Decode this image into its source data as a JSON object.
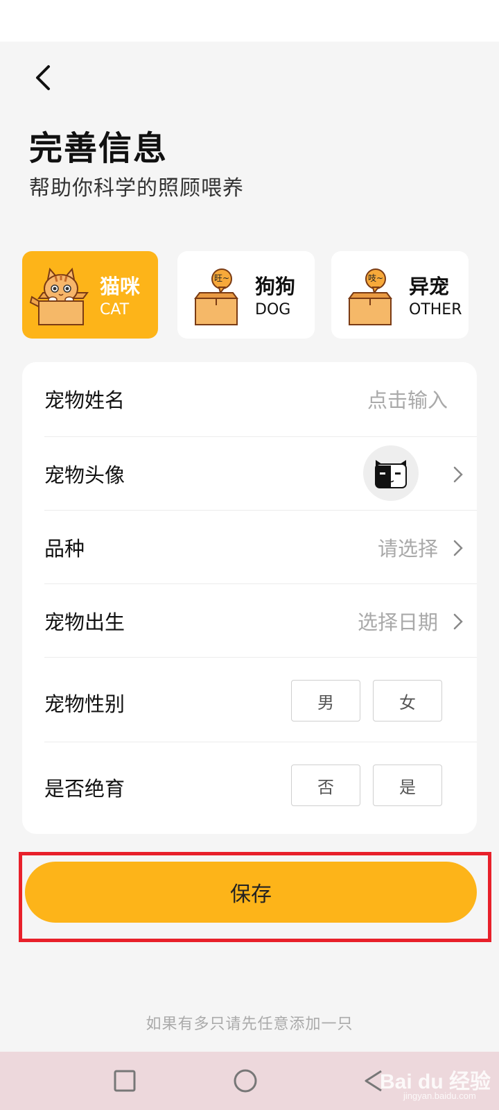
{
  "header": {
    "title": "完善信息",
    "subtitle": "帮助你科学的照顾喂养"
  },
  "pet_types": [
    {
      "cn": "猫咪",
      "en": "CAT",
      "selected": true,
      "bubble": ""
    },
    {
      "cn": "狗狗",
      "en": "DOG",
      "selected": false,
      "bubble": "旺~"
    },
    {
      "cn": "异宠",
      "en": "OTHER",
      "selected": false,
      "bubble": "吱~"
    }
  ],
  "form": {
    "name": {
      "label": "宠物姓名",
      "placeholder": "点击输入"
    },
    "avatar": {
      "label": "宠物头像"
    },
    "breed": {
      "label": "品种",
      "value": "请选择"
    },
    "birth": {
      "label": "宠物出生",
      "value": "选择日期"
    },
    "gender": {
      "label": "宠物性别",
      "options": [
        "男",
        "女"
      ]
    },
    "neutered": {
      "label": "是否绝育",
      "options": [
        "否",
        "是"
      ]
    }
  },
  "save_label": "保存",
  "hint": "如果有多只请先任意添加一只",
  "watermark": {
    "text": "Bai du 经验",
    "sub": "jingyan.baidu.com"
  },
  "colors": {
    "accent": "#fdb419",
    "highlight": "#e8202a",
    "placeholder": "#a9a9a9"
  },
  "icons": {
    "back": "chevron-left-icon",
    "nav_recent": "square-icon",
    "nav_home": "circle-icon",
    "nav_back": "triangle-left-icon"
  }
}
